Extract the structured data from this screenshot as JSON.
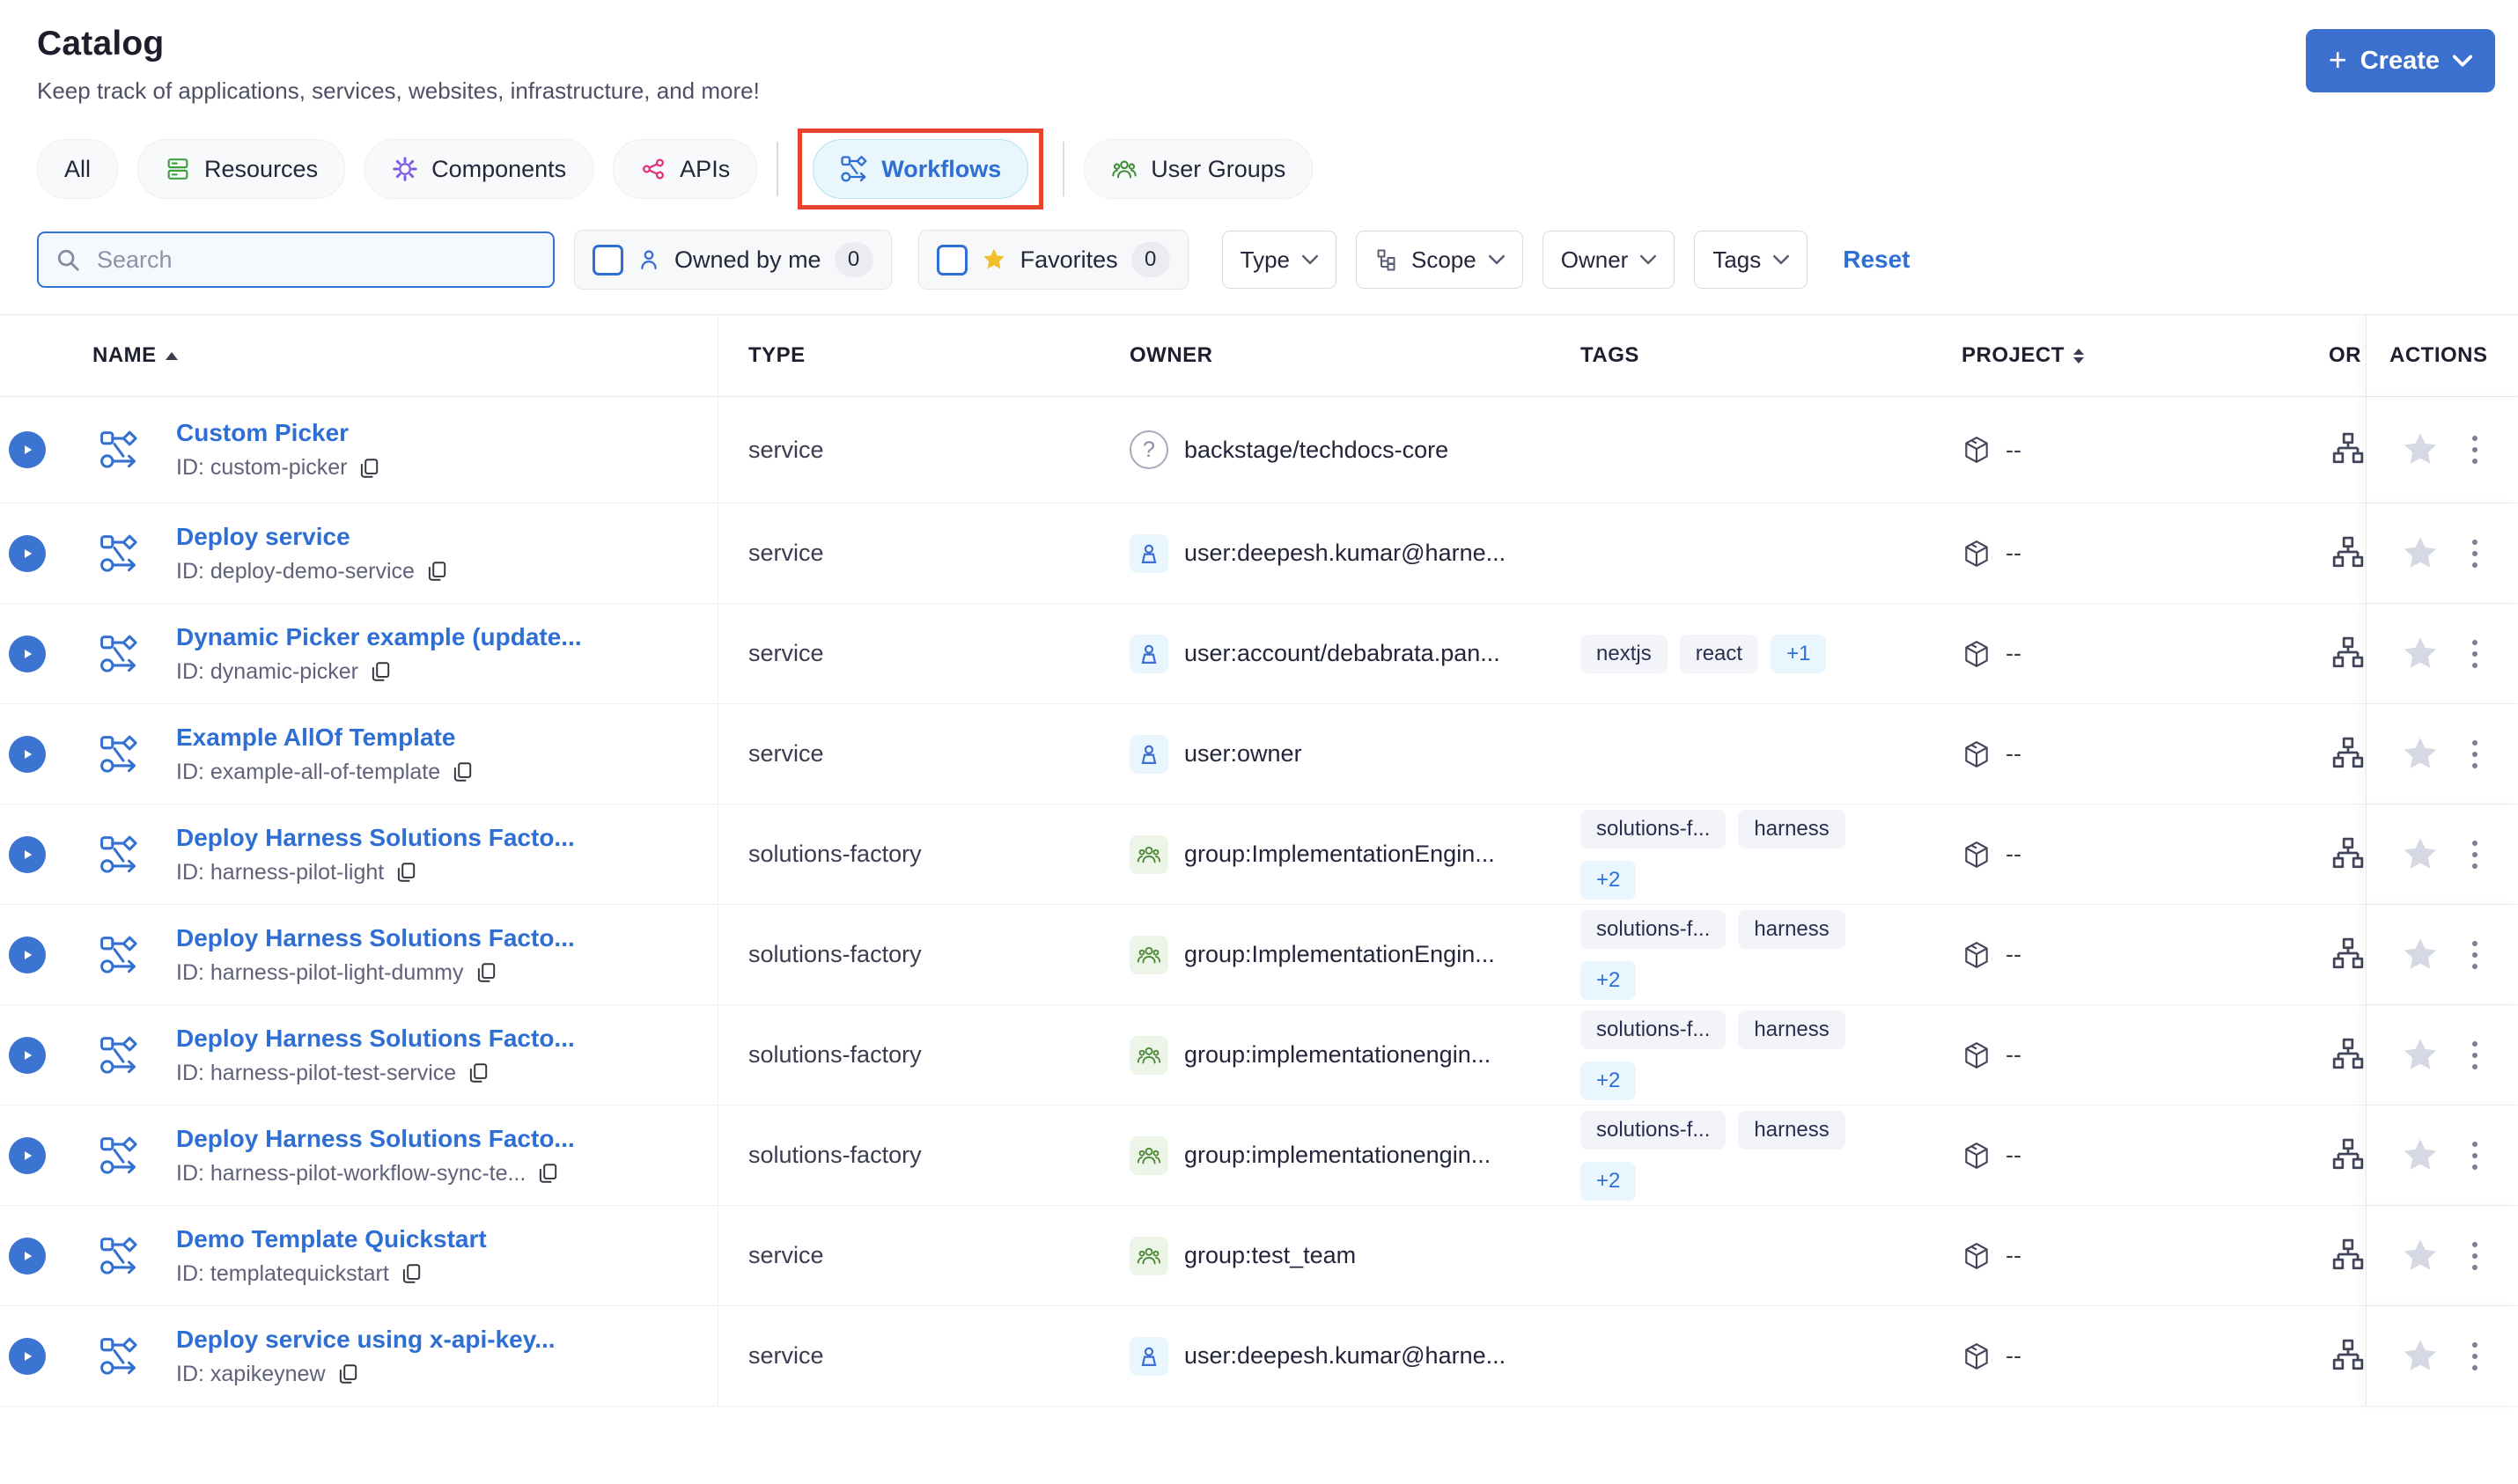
{
  "page": {
    "title": "Catalog",
    "subtitle": "Keep track of applications, services, websites, infrastructure, and more!"
  },
  "create_button": {
    "label": "Create",
    "plus": "+"
  },
  "tabs": [
    {
      "label": "All",
      "active": false
    },
    {
      "label": "Resources",
      "icon": "resources-icon",
      "icon_color": "#3fa13f",
      "active": false
    },
    {
      "label": "Components",
      "icon": "gear-icon",
      "icon_color": "#7c5ce4",
      "active": false
    },
    {
      "label": "APIs",
      "icon": "api-nodes-icon",
      "icon_color": "#e0307e",
      "active": false
    },
    {
      "label": "Workflows",
      "icon": "workflow-icon",
      "icon_color": "#2f6fd3",
      "active": true,
      "highlighted_with_red_box": true
    },
    {
      "label": "User Groups",
      "icon": "user-group-icon",
      "icon_color": "#3e8e35",
      "active": false
    }
  ],
  "filters": {
    "search_placeholder": "Search",
    "owned_by_me": {
      "label": "Owned by me",
      "count": "0"
    },
    "favorites": {
      "label": "Favorites",
      "count": "0"
    },
    "dropdowns": [
      "Type",
      "Scope",
      "Owner",
      "Tags"
    ],
    "reset_label": "Reset"
  },
  "table": {
    "columns": {
      "name": "NAME",
      "type": "TYPE",
      "owner": "OWNER",
      "tags": "TAGS",
      "project": "PROJECT",
      "org_truncated": "OR",
      "actions": "ACTIONS"
    },
    "project_value": "--",
    "rows": [
      {
        "name": "Custom Picker",
        "id": "ID: custom-picker",
        "type": "service",
        "owner": "backstage/techdocs-core",
        "owner_kind": "unknown",
        "tags": [],
        "more": ""
      },
      {
        "name": "Deploy service",
        "id": "ID: deploy-demo-service",
        "type": "service",
        "owner": "user:deepesh.kumar@harne...",
        "owner_kind": "user",
        "tags": [],
        "more": ""
      },
      {
        "name": "Dynamic Picker example (update...",
        "id": "ID: dynamic-picker",
        "type": "service",
        "owner": "user:account/debabrata.pan...",
        "owner_kind": "user",
        "tags": [
          "nextjs",
          "react"
        ],
        "more": "+1"
      },
      {
        "name": "Example AllOf Template",
        "id": "ID: example-all-of-template",
        "type": "service",
        "owner": "user:owner",
        "owner_kind": "user",
        "tags": [],
        "more": ""
      },
      {
        "name": "Deploy Harness Solutions Facto...",
        "id": "ID: harness-pilot-light",
        "type": "solutions-factory",
        "owner": "group:ImplementationEngin...",
        "owner_kind": "group",
        "tags": [
          "solutions-f...",
          "harness"
        ],
        "more": "+2"
      },
      {
        "name": "Deploy Harness Solutions Facto...",
        "id": "ID: harness-pilot-light-dummy",
        "type": "solutions-factory",
        "owner": "group:ImplementationEngin...",
        "owner_kind": "group",
        "tags": [
          "solutions-f...",
          "harness"
        ],
        "more": "+2"
      },
      {
        "name": "Deploy Harness Solutions Facto...",
        "id": "ID: harness-pilot-test-service",
        "type": "solutions-factory",
        "owner": "group:implementationengin...",
        "owner_kind": "group",
        "tags": [
          "solutions-f...",
          "harness"
        ],
        "more": "+2"
      },
      {
        "name": "Deploy Harness Solutions Facto...",
        "id": "ID: harness-pilot-workflow-sync-te...",
        "type": "solutions-factory",
        "owner": "group:implementationengin...",
        "owner_kind": "group",
        "tags": [
          "solutions-f...",
          "harness"
        ],
        "more": "+2"
      },
      {
        "name": "Demo Template Quickstart",
        "id": "ID: templatequickstart",
        "type": "service",
        "owner": "group:test_team",
        "owner_kind": "group",
        "tags": [],
        "more": ""
      },
      {
        "name": "Deploy service using x-api-key...",
        "id": "ID: xapikeynew",
        "type": "service",
        "owner": "user:deepesh.kumar@harne...",
        "owner_kind": "user",
        "tags": [],
        "more": ""
      }
    ]
  },
  "colors": {
    "accent_blue": "#3b70cf",
    "link_blue": "#2f6fd3",
    "active_tab_bg": "#e9f6fc",
    "annotation_red": "#e8432d",
    "star_yellow": "#f4bd2a",
    "favorite_star_gray": "#d6d8e3",
    "tag_bg": "#f3f4f9",
    "tag_more_bg": "#e9f6fd",
    "group_icon_green": "#4c8a38",
    "row_border": "#eef0f3"
  },
  "icons": [
    "plus-icon",
    "chevron-down-icon",
    "resources-icon",
    "gear-icon",
    "api-nodes-icon",
    "workflow-icon",
    "user-group-icon",
    "search-icon",
    "person-icon",
    "star-icon",
    "hierarchy-icon",
    "sort-asc-icon",
    "sort-icon",
    "play-icon",
    "copy-icon",
    "question-icon",
    "group-icon",
    "cube-icon",
    "org-chart-icon",
    "kebab-icon"
  ]
}
